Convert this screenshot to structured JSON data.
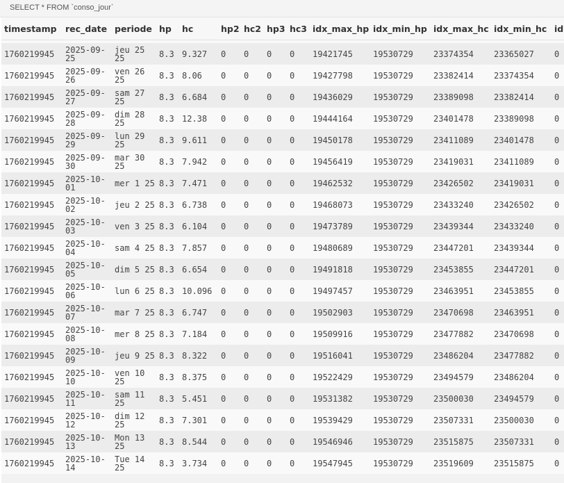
{
  "query": "SELECT * FROM `conso_jour`",
  "columns": [
    "timestamp",
    "rec_date",
    "periode",
    "hp",
    "hc",
    "hp2",
    "hc2",
    "hp3",
    "hc3",
    "idx_max_hp",
    "idx_min_hp",
    "idx_max_hc",
    "idx_min_hc",
    "id"
  ],
  "rows": [
    [
      "1760219945",
      "2025-09-25",
      "jeu 25 25",
      "8.3",
      "9.327",
      "0",
      "0",
      "0",
      "0",
      "19421745",
      "19530729",
      "23374354",
      "23365027",
      "0"
    ],
    [
      "1760219945",
      "2025-09-26",
      "ven 26 25",
      "8.3",
      "8.06",
      "0",
      "0",
      "0",
      "0",
      "19427798",
      "19530729",
      "23382414",
      "23374354",
      "0"
    ],
    [
      "1760219945",
      "2025-09-27",
      "sam 27 25",
      "8.3",
      "6.684",
      "0",
      "0",
      "0",
      "0",
      "19436029",
      "19530729",
      "23389098",
      "23382414",
      "0"
    ],
    [
      "1760219945",
      "2025-09-28",
      "dim 28 25",
      "8.3",
      "12.38",
      "0",
      "0",
      "0",
      "0",
      "19444164",
      "19530729",
      "23401478",
      "23389098",
      "0"
    ],
    [
      "1760219945",
      "2025-09-29",
      "lun 29 25",
      "8.3",
      "9.611",
      "0",
      "0",
      "0",
      "0",
      "19450178",
      "19530729",
      "23411089",
      "23401478",
      "0"
    ],
    [
      "1760219945",
      "2025-09-30",
      "mar 30 25",
      "8.3",
      "7.942",
      "0",
      "0",
      "0",
      "0",
      "19456419",
      "19530729",
      "23419031",
      "23411089",
      "0"
    ],
    [
      "1760219945",
      "2025-10-01",
      "mer 1 25",
      "8.3",
      "7.471",
      "0",
      "0",
      "0",
      "0",
      "19462532",
      "19530729",
      "23426502",
      "23419031",
      "0"
    ],
    [
      "1760219945",
      "2025-10-02",
      "jeu 2 25",
      "8.3",
      "6.738",
      "0",
      "0",
      "0",
      "0",
      "19468073",
      "19530729",
      "23433240",
      "23426502",
      "0"
    ],
    [
      "1760219945",
      "2025-10-03",
      "ven 3 25",
      "8.3",
      "6.104",
      "0",
      "0",
      "0",
      "0",
      "19473789",
      "19530729",
      "23439344",
      "23433240",
      "0"
    ],
    [
      "1760219945",
      "2025-10-04",
      "sam 4 25",
      "8.3",
      "7.857",
      "0",
      "0",
      "0",
      "0",
      "19480689",
      "19530729",
      "23447201",
      "23439344",
      "0"
    ],
    [
      "1760219945",
      "2025-10-05",
      "dim 5 25",
      "8.3",
      "6.654",
      "0",
      "0",
      "0",
      "0",
      "19491818",
      "19530729",
      "23453855",
      "23447201",
      "0"
    ],
    [
      "1760219945",
      "2025-10-06",
      "lun 6 25",
      "8.3",
      "10.096",
      "0",
      "0",
      "0",
      "0",
      "19497457",
      "19530729",
      "23463951",
      "23453855",
      "0"
    ],
    [
      "1760219945",
      "2025-10-07",
      "mar 7 25",
      "8.3",
      "6.747",
      "0",
      "0",
      "0",
      "0",
      "19502903",
      "19530729",
      "23470698",
      "23463951",
      "0"
    ],
    [
      "1760219945",
      "2025-10-08",
      "mer 8 25",
      "8.3",
      "7.184",
      "0",
      "0",
      "0",
      "0",
      "19509916",
      "19530729",
      "23477882",
      "23470698",
      "0"
    ],
    [
      "1760219945",
      "2025-10-09",
      "jeu 9 25",
      "8.3",
      "8.322",
      "0",
      "0",
      "0",
      "0",
      "19516041",
      "19530729",
      "23486204",
      "23477882",
      "0"
    ],
    [
      "1760219945",
      "2025-10-10",
      "ven 10 25",
      "8.3",
      "8.375",
      "0",
      "0",
      "0",
      "0",
      "19522429",
      "19530729",
      "23494579",
      "23486204",
      "0"
    ],
    [
      "1760219945",
      "2025-10-11",
      "sam 11 25",
      "8.3",
      "5.451",
      "0",
      "0",
      "0",
      "0",
      "19531382",
      "19530729",
      "23500030",
      "23494579",
      "0"
    ],
    [
      "1760219945",
      "2025-10-12",
      "dim 12 25",
      "8.3",
      "7.301",
      "0",
      "0",
      "0",
      "0",
      "19539429",
      "19530729",
      "23507331",
      "23500030",
      "0"
    ],
    [
      "1760219945",
      "2025-10-13",
      "Mon 13 25",
      "8.3",
      "8.544",
      "0",
      "0",
      "0",
      "0",
      "19546946",
      "19530729",
      "23515875",
      "23507331",
      "0"
    ],
    [
      "1760219945",
      "2025-10-14",
      "Tue 14 25",
      "8.3",
      "3.734",
      "0",
      "0",
      "0",
      "0",
      "19547945",
      "19530729",
      "23519609",
      "23515875",
      "0"
    ]
  ]
}
